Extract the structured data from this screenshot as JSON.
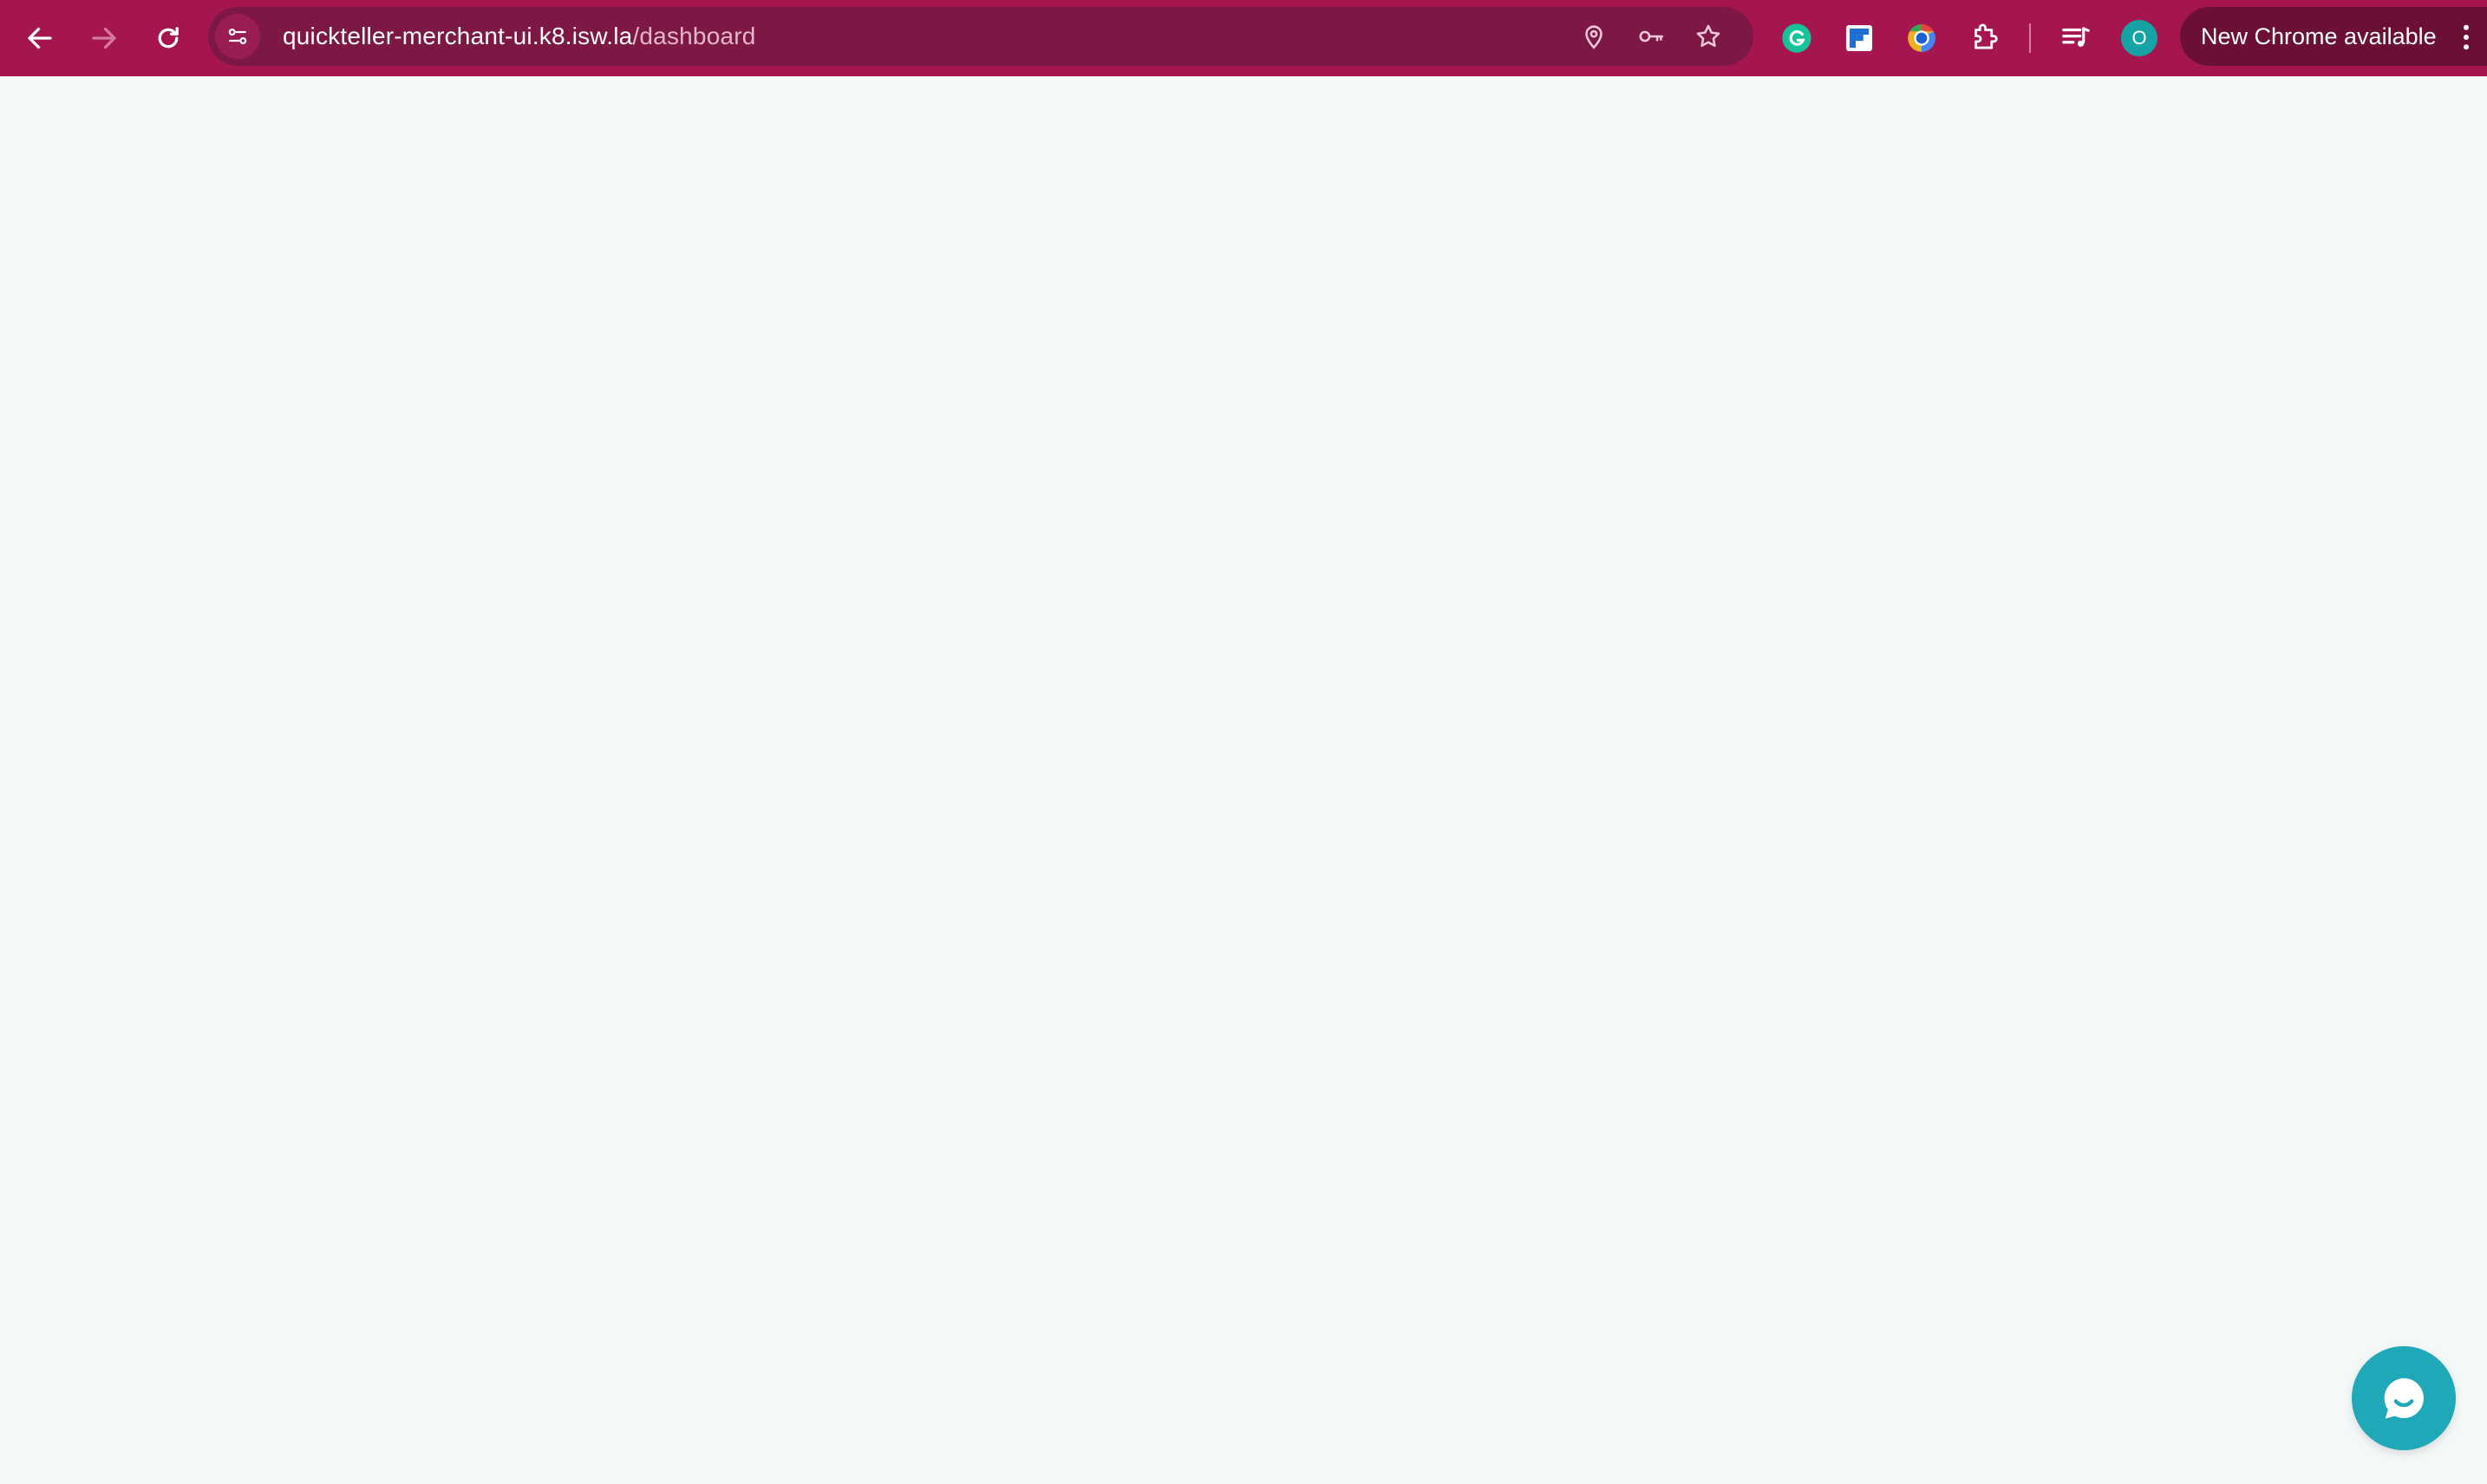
{
  "browser": {
    "theme_color": "#a5154f",
    "omnibox_color": "#7d1745",
    "url_host": "quickteller-merchant-ui.k8.isw.la",
    "url_path": "/dashboard",
    "nav": {
      "back_icon": "arrow-left-icon",
      "forward_icon": "arrow-right-icon",
      "reload_icon": "reload-icon"
    },
    "omnibox_icons": [
      "location-pin-icon",
      "key-icon",
      "star-icon"
    ],
    "extensions": [
      "grammarly-icon",
      "flipboard-extension-icon",
      "chrome-color-extension-icon",
      "puzzle-extensions-icon"
    ],
    "media_icon": "media-controls-icon",
    "profile_initial": "O",
    "profile_color": "#16a3a3",
    "update_label": "New Chrome available"
  },
  "page": {
    "background": "#f4f8f8",
    "chat_button_color": "#1fa8b8",
    "chat_icon": "chat-bubble-icon"
  }
}
